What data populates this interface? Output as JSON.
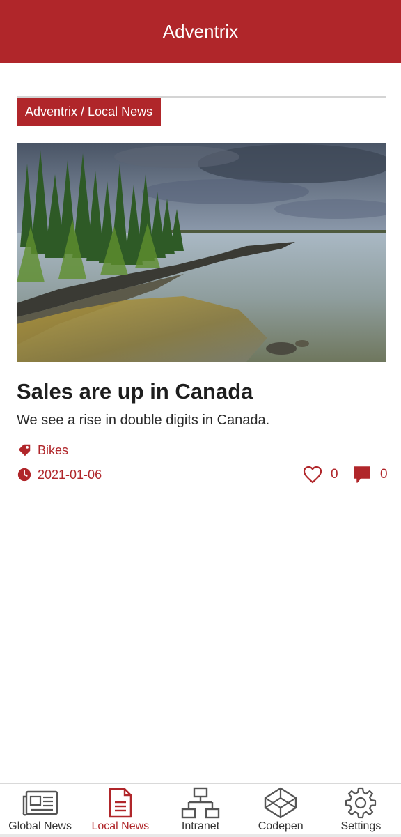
{
  "app": {
    "title": "Adventrix"
  },
  "breadcrumb": {
    "label": "Adventrix / Local News"
  },
  "article": {
    "image_alt": "Lakeshore with pine trees under cloudy sky",
    "title": "Sales are up in Canada",
    "summary": "We see a rise in double digits in Canada.",
    "tag": "Bikes",
    "date": "2021-01-06",
    "likes": "0",
    "comments": "0"
  },
  "icons": {
    "tag": "tag-icon",
    "date": "clock-icon",
    "likes": "heart-icon",
    "comments": "comment-icon"
  },
  "tabs": [
    {
      "label": "Global News",
      "icon": "newspaper-icon",
      "active": false
    },
    {
      "label": "Local News",
      "icon": "document-icon",
      "active": true
    },
    {
      "label": "Intranet",
      "icon": "sitemap-icon",
      "active": false
    },
    {
      "label": "Codepen",
      "icon": "codepen-icon",
      "active": false
    },
    {
      "label": "Settings",
      "icon": "gear-icon",
      "active": false
    }
  ],
  "colors": {
    "accent": "#b0262a",
    "text": "#222222",
    "divider": "#d4d4d4"
  }
}
